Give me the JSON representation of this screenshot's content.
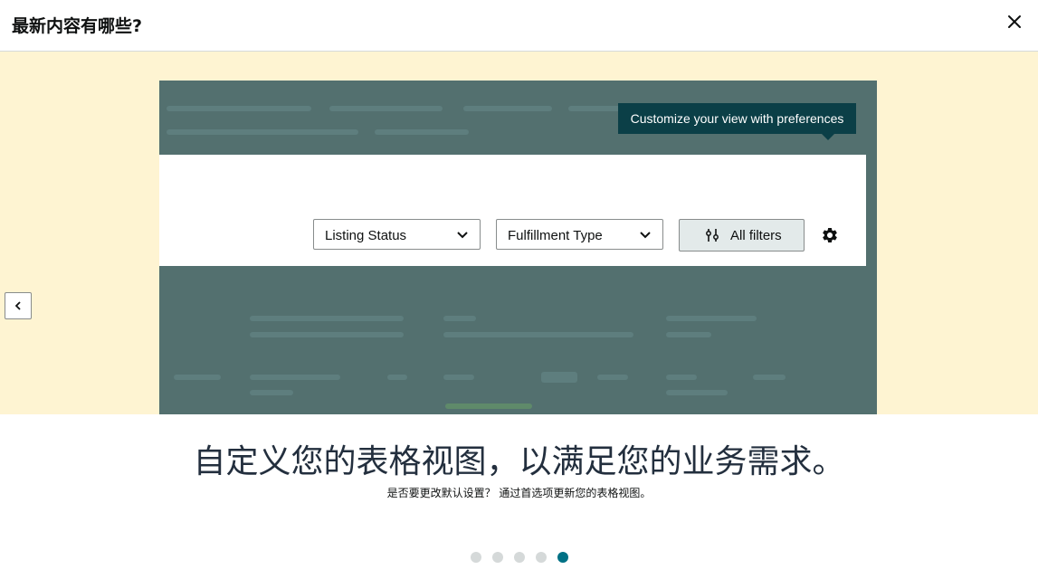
{
  "modal": {
    "title": "最新内容有哪些?",
    "close_icon": "close-icon"
  },
  "slide": {
    "tooltip": "Customize your view with preferences",
    "listing_status": "Listing Status",
    "fulfillment_type": "Fulfillment Type",
    "all_filters": "All filters",
    "heading": "自定义您的表格视图，以满足您的业务需求。",
    "subtext": "是否要更改默认设置？ 通过首选项更新您的表格视图。"
  },
  "carousel": {
    "total": 5,
    "active_index": 4
  },
  "colors": {
    "banner_bg": "#fef4d2",
    "overlay": "#53706f",
    "tooltip_bg": "#0b3f47",
    "active_dot": "#007185",
    "inactive_dot": "#d5d9d9"
  }
}
